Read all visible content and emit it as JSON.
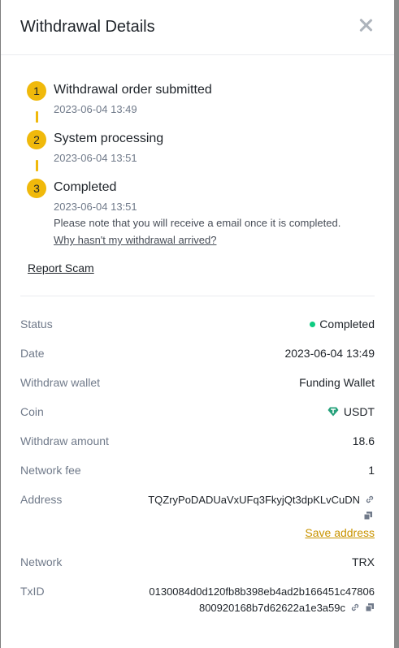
{
  "modal": {
    "title": "Withdrawal Details"
  },
  "timeline": {
    "steps": [
      {
        "number": "1",
        "title": "Withdrawal order submitted",
        "time": "2023-06-04 13:49"
      },
      {
        "number": "2",
        "title": "System processing",
        "time": "2023-06-04 13:51"
      },
      {
        "number": "3",
        "title": "Completed",
        "time": "2023-06-04 13:51",
        "note": "Please note that you will receive a email once it is completed.",
        "link": "Why hasn't my withdrawal arrived?"
      }
    ]
  },
  "report_scam": "Report Scam",
  "details": {
    "status_label": "Status",
    "status_value": "Completed",
    "date_label": "Date",
    "date_value": "2023-06-04 13:49",
    "wallet_label": "Withdraw wallet",
    "wallet_value": "Funding Wallet",
    "coin_label": "Coin",
    "coin_value": "USDT",
    "amount_label": "Withdraw amount",
    "amount_value": "18.6",
    "fee_label": "Network fee",
    "fee_value": "1",
    "address_label": "Address",
    "address_value": "TQZryPoDADUaVxUFq3FkyjQt3dpKLvCuDN",
    "save_address": "Save address",
    "network_label": "Network",
    "network_value": "TRX",
    "txid_label": "TxID",
    "txid_line1": "0130084d0d120fb8b398eb4ad2b166451c47806",
    "txid_line2": "800920168b7d62622a1e3a59c"
  },
  "colors": {
    "accent": "#f0b90b",
    "link_gold": "#c99400",
    "success": "#0ecb81",
    "tether": "#26a17b"
  },
  "icons": {
    "close": "close-icon",
    "coin": "usdt-icon",
    "link": "link-icon",
    "copy": "copy-icon"
  }
}
